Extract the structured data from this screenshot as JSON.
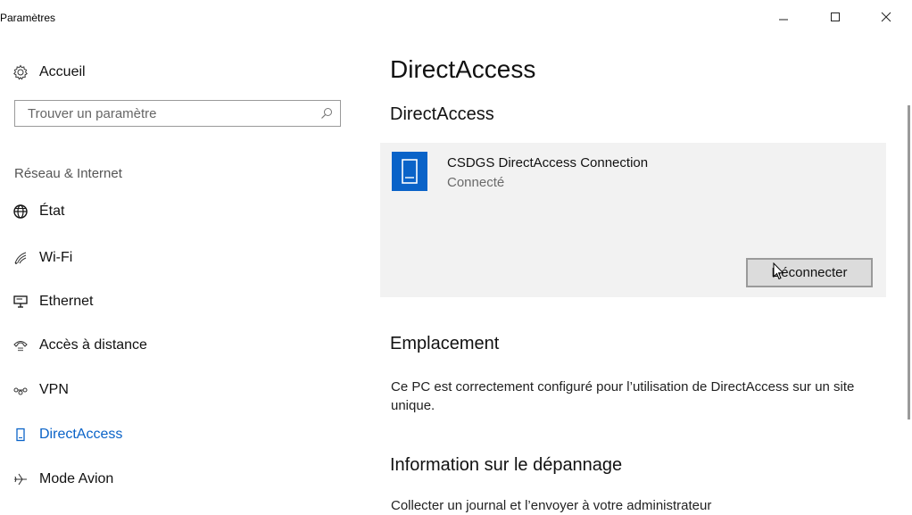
{
  "window": {
    "title": "Paramètres",
    "controls": [
      "minimize",
      "maximize",
      "close"
    ]
  },
  "sidebar": {
    "home_label": "Accueil",
    "search_placeholder": "Trouver un paramètre",
    "section_label": "Réseau & Internet",
    "items": [
      {
        "label": "État",
        "icon": "globe-icon",
        "selected": false
      },
      {
        "label": "Wi-Fi",
        "icon": "wifi-icon",
        "selected": false
      },
      {
        "label": "Ethernet",
        "icon": "ethernet-icon",
        "selected": false
      },
      {
        "label": "Accès à distance",
        "icon": "dialup-icon",
        "selected": false
      },
      {
        "label": "VPN",
        "icon": "vpn-icon",
        "selected": false
      },
      {
        "label": "DirectAccess",
        "icon": "directaccess-icon",
        "selected": true
      },
      {
        "label": "Mode Avion",
        "icon": "airplane-icon",
        "selected": false
      }
    ]
  },
  "main": {
    "page_title": "DirectAccess",
    "section_title": "DirectAccess",
    "connection": {
      "name": "CSDGS DirectAccess Connection",
      "status": "Connecté",
      "button_label": "Déconnecter"
    },
    "location": {
      "title": "Emplacement",
      "text": "Ce PC est correctement configuré pour l’utilisation de DirectAccess sur un site unique."
    },
    "troubleshooting": {
      "title": "Information sur le dépannage",
      "text": "Collecter un journal et l’envoyer à votre administrateur"
    }
  },
  "colors": {
    "accent": "#0a63c8",
    "card_bg": "#f2f2f2",
    "button_bg": "#dcdcdc"
  }
}
